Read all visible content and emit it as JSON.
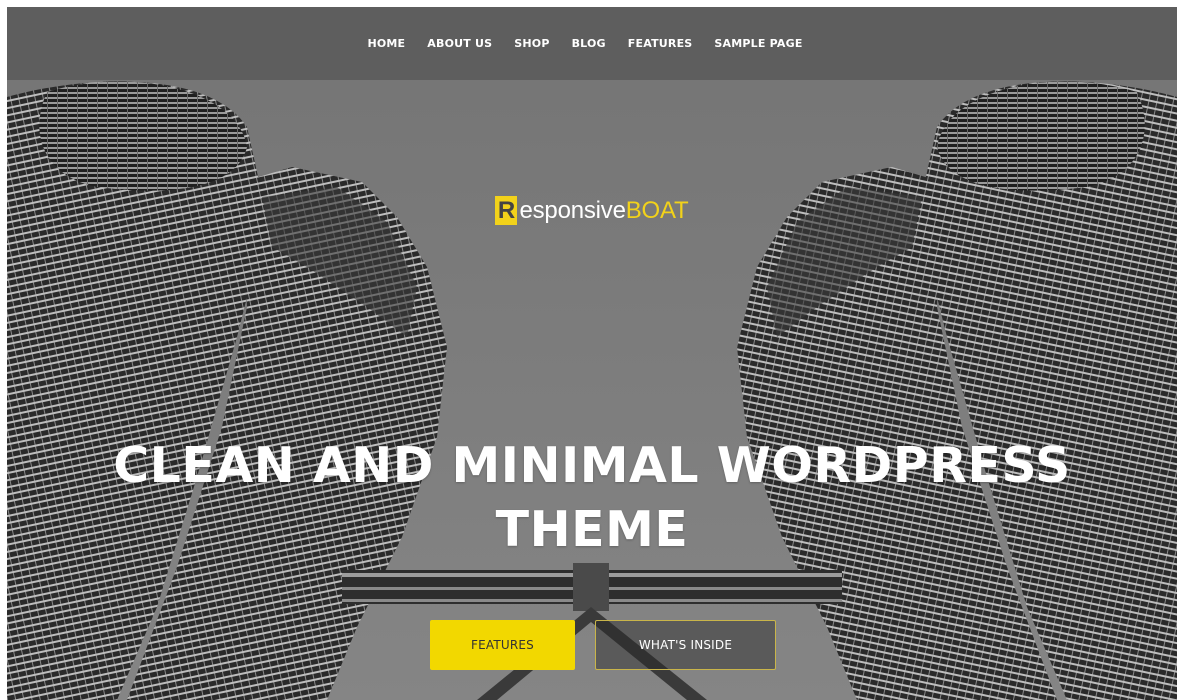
{
  "nav": {
    "items": [
      "HOME",
      "ABOUT US",
      "SHOP",
      "BLOG",
      "FEATURES",
      "SAMPLE PAGE"
    ]
  },
  "logo": {
    "initial": "R",
    "middle": "esponsive",
    "end": "BOAT"
  },
  "hero": {
    "title_line1": "CLEAN AND MINIMAL WORDPRESS",
    "title_line2": "THEME",
    "background_image": "twin-towers-building-photo"
  },
  "buttons": {
    "features_label": "FEATURES",
    "inside_label": "WHAT'S INSIDE"
  },
  "colors": {
    "accent": "#f2d800",
    "logo_yellow": "#f2d21a",
    "nav_bg": "#5c5c5c",
    "sky": "#7a7a7a"
  }
}
